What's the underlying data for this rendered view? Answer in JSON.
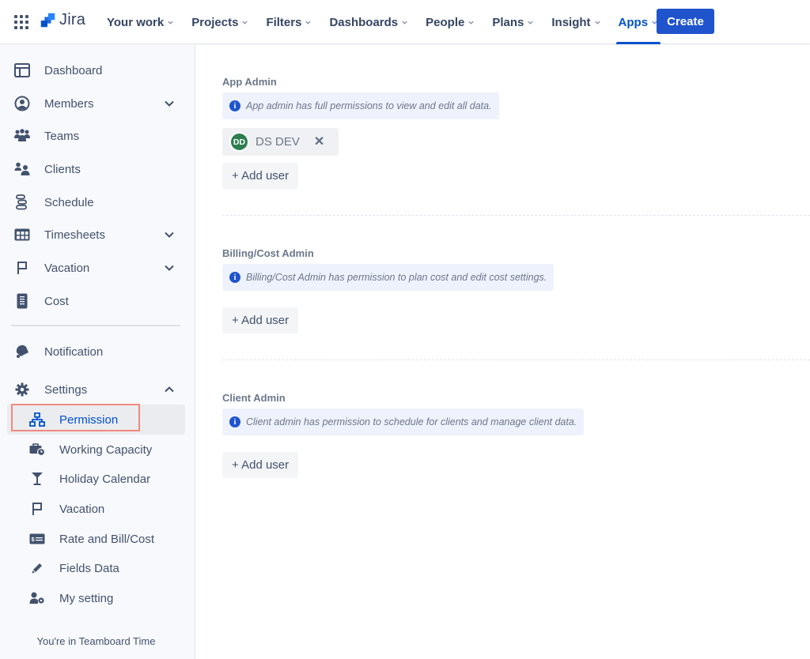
{
  "topnav": {
    "app_name": "Jira",
    "items": [
      {
        "label": "Your work",
        "active": false
      },
      {
        "label": "Projects",
        "active": false
      },
      {
        "label": "Filters",
        "active": false
      },
      {
        "label": "Dashboards",
        "active": false
      },
      {
        "label": "People",
        "active": false
      },
      {
        "label": "Plans",
        "active": false
      },
      {
        "label": "Insight",
        "active": false
      },
      {
        "label": "Apps",
        "active": true
      }
    ],
    "create_label": "Create",
    "accent_color": "#0052cc",
    "create_color": "#1f54cc"
  },
  "sidebar": {
    "items": [
      {
        "label": "Dashboard",
        "icon": "dashboard-icon",
        "expandable": false
      },
      {
        "label": "Members",
        "icon": "user-circle-icon",
        "expandable": true
      },
      {
        "label": "Teams",
        "icon": "people-group-icon",
        "expandable": false
      },
      {
        "label": "Clients",
        "icon": "clients-icon",
        "expandable": false
      },
      {
        "label": "Schedule",
        "icon": "schedule-icon",
        "expandable": false
      },
      {
        "label": "Timesheets",
        "icon": "table-icon",
        "expandable": true
      },
      {
        "label": "Vacation",
        "icon": "flag-icon",
        "expandable": true
      },
      {
        "label": "Cost",
        "icon": "calculator-icon",
        "expandable": false
      }
    ],
    "notification_label": "Notification",
    "settings": {
      "label": "Settings",
      "expanded": true,
      "children": [
        {
          "label": "Permission",
          "icon": "hierarchy-icon",
          "active": true
        },
        {
          "label": "Working Capacity",
          "icon": "briefcase-clock-icon",
          "active": false
        },
        {
          "label": "Holiday Calendar",
          "icon": "cocktail-icon",
          "active": false
        },
        {
          "label": "Vacation",
          "icon": "flag-icon",
          "active": false
        },
        {
          "label": "Rate and Bill/Cost",
          "icon": "money-card-icon",
          "active": false
        },
        {
          "label": "Fields Data",
          "icon": "pencil-icon",
          "active": false
        },
        {
          "label": "My setting",
          "icon": "user-gear-icon",
          "active": false
        }
      ]
    },
    "footer": "You're in Teamboard Time"
  },
  "main": {
    "sections": [
      {
        "title": "App Admin",
        "info": "App admin has full permissions to view and edit all data.",
        "users": [
          {
            "initials": "DD",
            "name": "DS DEV",
            "avatar_color": "#2e7d4f"
          }
        ],
        "add_label": "+ Add user"
      },
      {
        "title": "Billing/Cost Admin",
        "info": "Billing/Cost Admin has permission to plan cost and edit cost settings.",
        "users": [],
        "add_label": "+ Add user"
      },
      {
        "title": "Client Admin",
        "info": "Client admin has permission to schedule for clients and manage client data.",
        "users": [],
        "add_label": "+ Add user"
      }
    ]
  }
}
